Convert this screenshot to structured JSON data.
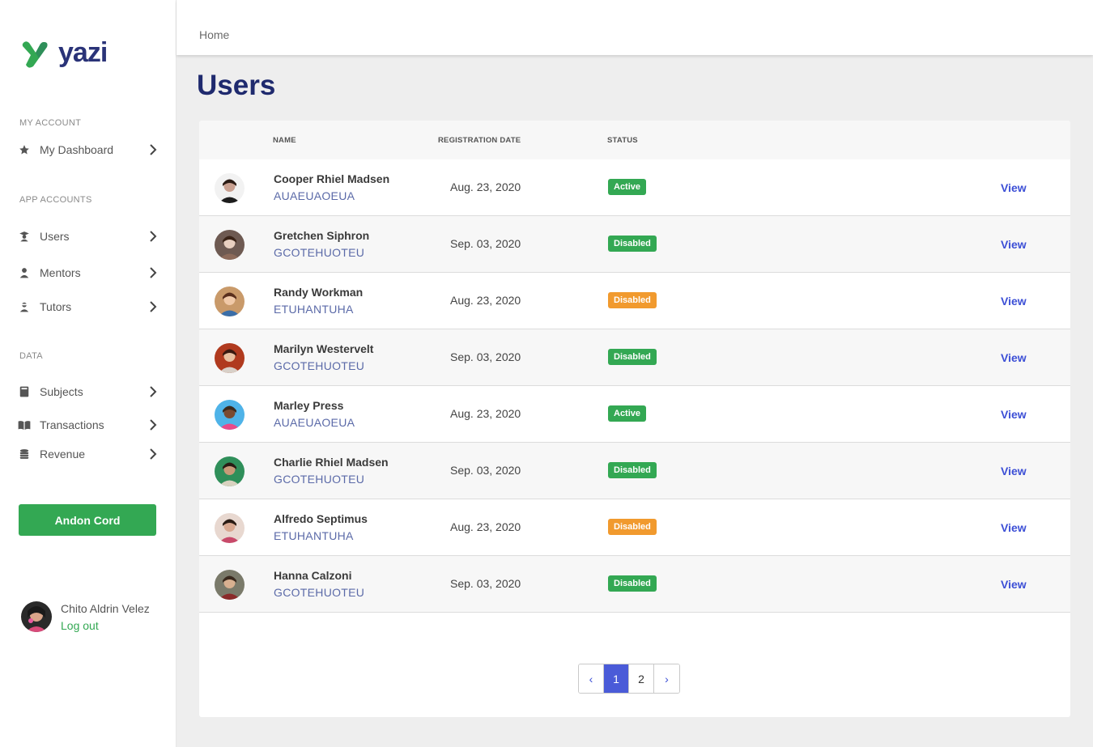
{
  "brand": {
    "name": "yazi",
    "primary": "#2a3378",
    "accent": "#33a853"
  },
  "sidebar": {
    "sections": [
      {
        "title": "MY ACCOUNT",
        "items": [
          {
            "label": "My Dashboard",
            "icon": "star-icon"
          }
        ]
      },
      {
        "title": "APP ACCOUNTS",
        "items": [
          {
            "label": "Users",
            "icon": "users-icon"
          },
          {
            "label": "Mentors",
            "icon": "mentor-icon"
          },
          {
            "label": "Tutors",
            "icon": "tutor-icon"
          }
        ]
      },
      {
        "title": "DATA",
        "items": [
          {
            "label": "Subjects",
            "icon": "book-icon"
          },
          {
            "label": "Transactions",
            "icon": "open-book-icon"
          },
          {
            "label": "Revenue",
            "icon": "coins-icon"
          }
        ]
      }
    ],
    "andon_label": "Andon Cord",
    "current_user": {
      "name": "Chito Aldrin Velez",
      "logout_label": "Log out"
    }
  },
  "header": {
    "breadcrumb": "Home"
  },
  "page": {
    "title": "Users"
  },
  "table": {
    "columns": {
      "name": "NAME",
      "registration_date": "REGISTRATION DATE",
      "status": "STATUS"
    },
    "view_label": "View",
    "rows": [
      {
        "name": "Cooper Rhiel Madsen",
        "code": "AUAEUAOEUA",
        "date": "Aug. 23, 2020",
        "status": "Active",
        "status_color": "#33a853"
      },
      {
        "name": "Gretchen Siphron",
        "code": "GCOTEHUOTEU",
        "date": "Sep. 03, 2020",
        "status": "Disabled",
        "status_color": "#33a853"
      },
      {
        "name": "Randy Workman",
        "code": "ETUHANTUHA",
        "date": "Aug. 23, 2020",
        "status": "Disabled",
        "status_color": "#f19a2e"
      },
      {
        "name": "Marilyn Westervelt",
        "code": "GCOTEHUOTEU",
        "date": "Sep. 03, 2020",
        "status": "Disabled",
        "status_color": "#33a853"
      },
      {
        "name": "Marley Press",
        "code": "AUAEUAOEUA",
        "date": "Aug. 23, 2020",
        "status": "Active",
        "status_color": "#33a853"
      },
      {
        "name": "Charlie Rhiel Madsen",
        "code": "GCOTEHUOTEU",
        "date": "Sep. 03, 2020",
        "status": "Disabled",
        "status_color": "#33a853"
      },
      {
        "name": "Alfredo Septimus",
        "code": "ETUHANTUHA",
        "date": "Aug. 23, 2020",
        "status": "Disabled",
        "status_color": "#f19a2e"
      },
      {
        "name": "Hanna Calzoni",
        "code": "GCOTEHUOTEU",
        "date": "Sep. 03, 2020",
        "status": "Disabled",
        "status_color": "#33a853"
      }
    ]
  },
  "pagination": {
    "prev": "‹",
    "pages": [
      "1",
      "2"
    ],
    "current": "1",
    "next": "›"
  }
}
